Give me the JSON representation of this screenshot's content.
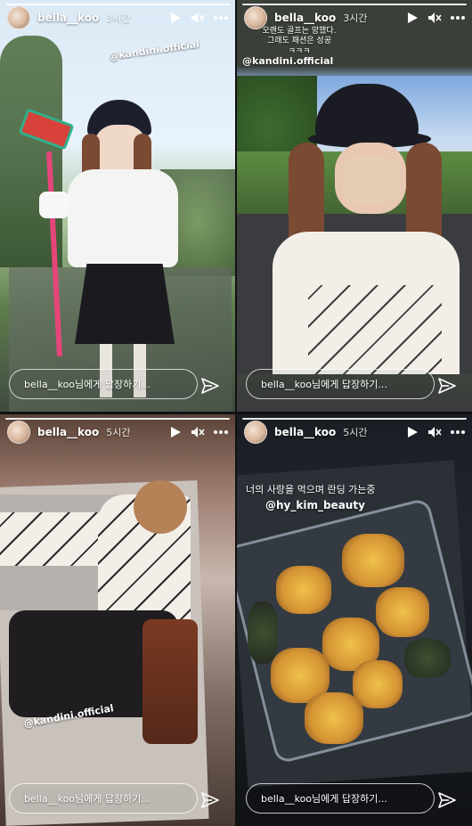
{
  "stories": [
    {
      "username": "bella__koo",
      "time": "3시간",
      "tag": "@kandini.official",
      "reply_placeholder": "bella__koo님에게 답장하기...",
      "caption": []
    },
    {
      "username": "bella__koo",
      "time": "3시간",
      "tag": "@kandini.official",
      "reply_placeholder": "bella__koo님에게 답장하기...",
      "caption": [
        "오랜도 골프는 망했다.",
        "그래도 패션은 성공",
        "ㅋㅋㅋ"
      ]
    },
    {
      "username": "bella__koo",
      "time": "5시간",
      "tag": "@kandini.official",
      "reply_placeholder": "bella__koo님에게 답장하기...",
      "caption": []
    },
    {
      "username": "bella__koo",
      "time": "5시간",
      "tag": "@hy_kim_beauty",
      "reply_placeholder": "bella__koo님에게 답장하기...",
      "caption": [
        "너의 사랑을 먹으며 란딩 가는중"
      ]
    }
  ],
  "icons": {
    "play": "play-icon",
    "mute": "mute-icon",
    "more": "more-icon",
    "send": "send-icon"
  }
}
